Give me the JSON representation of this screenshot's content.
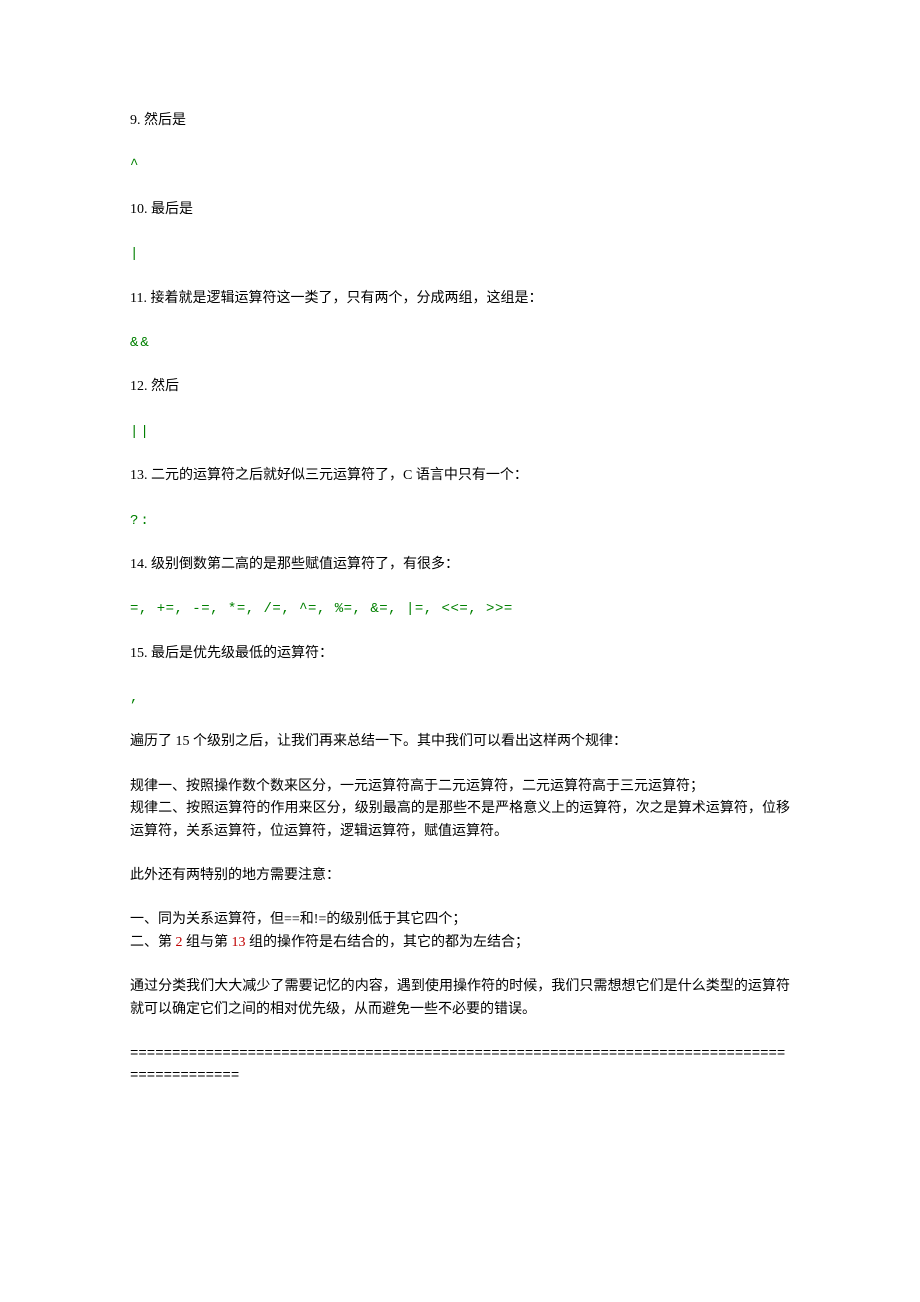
{
  "items": {
    "n9_label": "9. 然后是",
    "n9_code": "^",
    "n10_label": "10. 最后是",
    "n10_code": "|",
    "n11_label": "11. 接着就是逻辑运算符这一类了，只有两个，分成两组，这组是：",
    "n11_code": "&&",
    "n12_label": "12. 然后",
    "n12_code": "||",
    "n13_label": "13. 二元的运算符之后就好似三元运算符了，C 语言中只有一个：",
    "n13_code": "?:",
    "n14_label": "14. 级别倒数第二高的是那些赋值运算符了，有很多：",
    "n14_code": "=,  +=,  -=,  *=,  /=,  ^=,  %=,  &=, |=,  <<=,  >>=",
    "n15_label": "15. 最后是优先级最低的运算符：",
    "n15_code": ","
  },
  "summary": {
    "intro": "遍历了 15 个级别之后，让我们再来总结一下。其中我们可以看出这样两个规律：",
    "rule1": "规律一、按照操作数个数来区分，一元运算符高于二元运算符，二元运算符高于三元运算符；",
    "rule2": "规律二、按照运算符的作用来区分，级别最高的是那些不是严格意义上的运算符，次之是算术运算符，位移运算符，关系运算符，位运算符，逻辑运算符，赋值运算符。",
    "notes_intro": "此外还有两特别的地方需要注意：",
    "note1": "一、同为关系运算符，但==和!=的级别低于其它四个；",
    "note2_a": "二、第 ",
    "note2_red1": "2",
    "note2_b": " 组与第 ",
    "note2_red2": "13",
    "note2_c": " 组的操作符是右结合的，其它的都为左结合；",
    "conclusion": "通过分类我们大大减少了需要记忆的内容，遇到使用操作符的时候，我们只需想想它们是什么类型的运算符就可以确定它们之间的相对优先级，从而避免一些不必要的错误。"
  },
  "divider": "==========================================================================================="
}
